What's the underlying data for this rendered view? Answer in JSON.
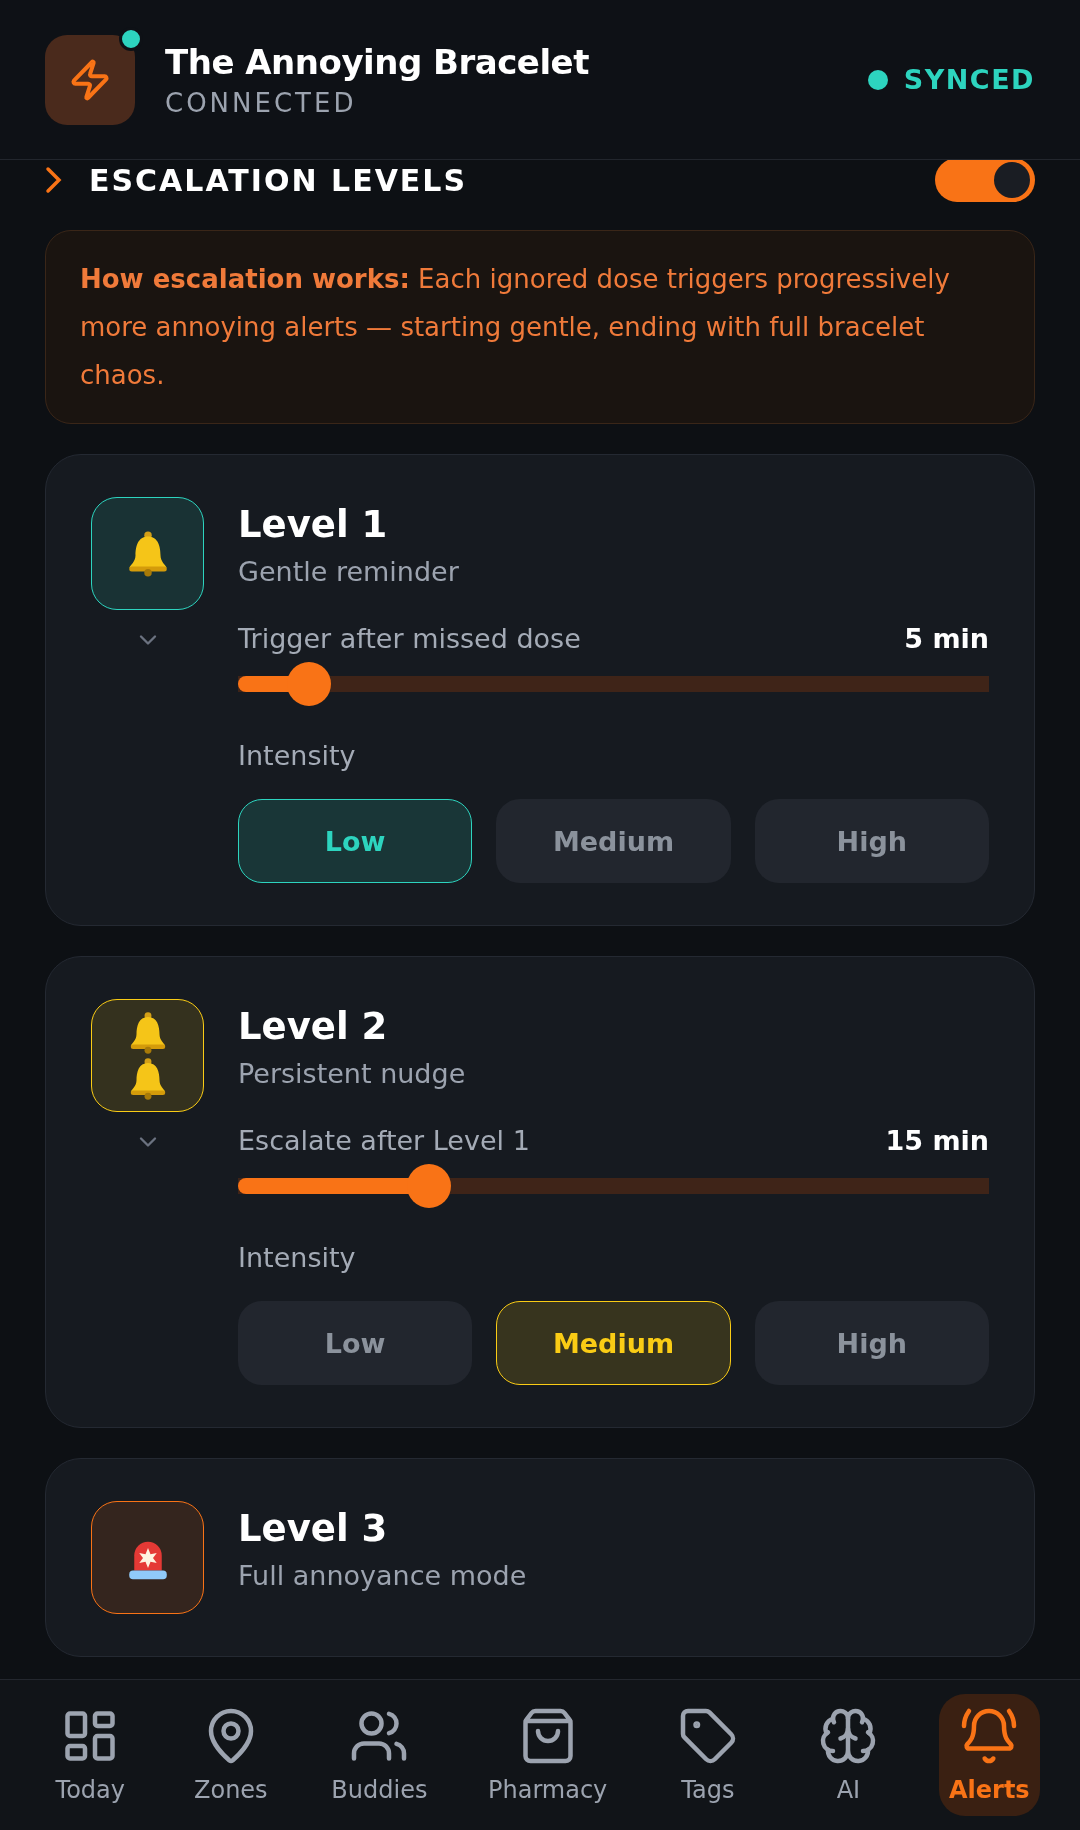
{
  "header": {
    "title": "The Annoying Bracelet",
    "status": "CONNECTED",
    "online": true,
    "sync": "SYNCED"
  },
  "section": {
    "title": "ESCALATION LEVELS",
    "on": true
  },
  "info": "**How escalation works:** Each ignored dose triggers progressively more annoying alerts — starting gentle, ending with full bracelet chaos.",
  "levels": [
    {
      "title": "Level 1",
      "subtitle": "Gentle reminder",
      "color": "#2dd4bf",
      "slider_label": "Trigger after missed dose",
      "reading": "5 min",
      "level": 0.095,
      "intensity_label": "Intensity",
      "options": [
        {
          "label": "Low",
          "selected": true
        },
        {
          "label": "Medium",
          "selected": false
        },
        {
          "label": "High",
          "selected": false
        }
      ]
    },
    {
      "title": "Level 2",
      "subtitle": "Persistent nudge",
      "color": "#facc15",
      "slider_label": "Escalate after Level 1",
      "reading": "15 min",
      "level": 0.254,
      "intensity_label": "Intensity",
      "options": [
        {
          "label": "Low",
          "selected": false
        },
        {
          "label": "Medium",
          "selected": true
        },
        {
          "label": "High",
          "selected": false
        }
      ]
    },
    {
      "title": "Level 3",
      "subtitle": "Full annoyance mode",
      "color": "#f97316"
    }
  ],
  "nav": [
    {
      "label": "Today",
      "selected": false
    },
    {
      "label": "Zones",
      "selected": false
    },
    {
      "label": "Buddies",
      "selected": false
    },
    {
      "label": "Pharmacy",
      "selected": false
    },
    {
      "label": "Tags",
      "selected": false
    },
    {
      "label": "AI",
      "selected": false
    },
    {
      "label": "Alerts",
      "selected": true
    }
  ]
}
